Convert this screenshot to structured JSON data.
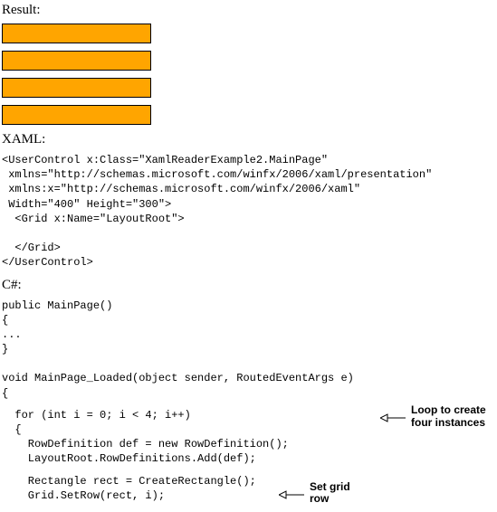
{
  "headings": {
    "result": "Result:",
    "xaml": "XAML:",
    "csharp": "C#:"
  },
  "bar_count": 4,
  "xaml_code": "<UserControl x:Class=\"XamlReaderExample2.MainPage\"\n xmlns=\"http://schemas.microsoft.com/winfx/2006/xaml/presentation\"\n xmlns:x=\"http://schemas.microsoft.com/winfx/2006/xaml\"\n Width=\"400\" Height=\"300\">\n  <Grid x:Name=\"LayoutRoot\">\n\n  </Grid>\n</UserControl>",
  "csharp_code_top": "public MainPage()\n{\n...\n}\n\nvoid MainPage_Loaded(object sender, RoutedEventArgs e)\n{",
  "csharp_code_forloop": "  for (int i = 0; i < 4; i++)\n  {\n    RowDefinition def = new RowDefinition();\n    LayoutRoot.RowDefinitions.Add(def);\n",
  "csharp_code_rectblock": "    Rectangle rect = CreateRectangle();\n    Grid.SetRow(rect, i);",
  "annotations": {
    "loop": "Loop to create\nfour instances",
    "setrow": "Set grid\nrow"
  }
}
